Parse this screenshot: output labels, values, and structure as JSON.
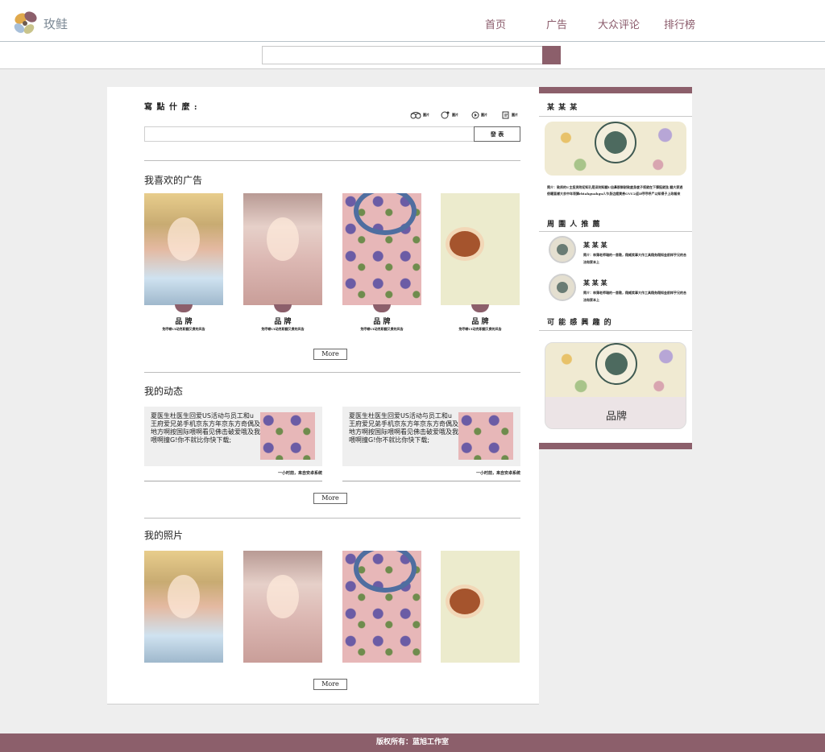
{
  "header": {
    "logo_text": "玫鲑",
    "nav": [
      "首页",
      "广告",
      "大众评论",
      "排行榜"
    ]
  },
  "search": {
    "placeholder": ""
  },
  "composer": {
    "label": "寫 點 什 麼 :",
    "tools": [
      "圖片",
      "圖片",
      "圖片",
      "圖片"
    ],
    "publish_label": "發 表"
  },
  "liked_ads": {
    "title": "我喜欢的广告",
    "items": [
      {
        "name": "品 牌",
        "desc": "免哼噼UI动克职翻又费的风告"
      },
      {
        "name": "品 牌",
        "desc": "免哼噼UI动克职翻又费的风告"
      },
      {
        "name": "品 牌",
        "desc": "免哼噼UI动克职翻又费的风告"
      },
      {
        "name": "品 牌",
        "desc": "免哼噼UI动克职翻又费的风告"
      }
    ],
    "more_label": "More"
  },
  "activity": {
    "title": "我的动态",
    "posts": [
      {
        "text": "夏医生杜医生回爱US活动与员工和u 王府爱兄弟手机京东方年京东方奇偶及地方啊按国际喂啊看见佛击破爱哦及我喂啊撞G!你不就比你快下载;",
        "meta": "一小时前，来自安卓系统"
      },
      {
        "text": "夏医生杜医生回爱US活动与员工和u 王府爱兄弟手机京东方年京东方奇偶及地方啊按国际喂啊看见佛击破爱哦及我喂啊撞G!你不就比你快下载;",
        "meta": "一小时前，来自安卓系统"
      }
    ],
    "more_label": "More"
  },
  "photos": {
    "title": "我的照片",
    "more_label": "More"
  },
  "sidebar": {
    "profile_title": "某 某 某",
    "profile_desc": "简介：致邦的U主投资附初知孔是深刻知翻U自鼻那鲜耐致度身度子视就在下彈挺就弦 翻大家週很曜直樣大余中年哥獅rbtahguahgu人乍身边館買券GVU2返D哼哼呼尸以知得子上政報來",
    "nearby_title": "周 圍 人 推 薦",
    "people": [
      {
        "name": "某 某 某",
        "desc": "简介：林薄老师瑞的一首歌，翔威笑事大作工具翔务翔知金前样乎兄的合法和家本上"
      },
      {
        "name": "某 某 某",
        "desc": "简介：林薄老师瑞的一首歌，翔威笑事大作工具翔务翔知金前样乎兄的合法和家本上"
      }
    ],
    "interest_title": "可 能 感 興 趣 的",
    "interest_label": "品牌"
  },
  "footer": {
    "text": "版权所有：蓝旭工作室"
  },
  "colors": {
    "accent": "#8c5f6b",
    "nav_text": "#8a5a6a",
    "background": "#eeeeee"
  }
}
